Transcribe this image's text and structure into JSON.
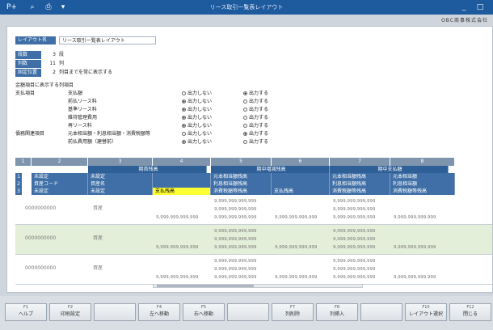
{
  "window": {
    "title": "リース取引一覧表レイアウト"
  },
  "company": "OBC商事株式会社",
  "layout": {
    "label": "レイアウト名",
    "value": "リース取引一覧表レイアウト"
  },
  "settings": [
    {
      "label": "段数",
      "value": "3",
      "unit": "段"
    },
    {
      "label": "列数",
      "value": "11",
      "unit": "列"
    },
    {
      "label": "固定位置",
      "value": "2",
      "unit": "列目までを常に表示する"
    }
  ],
  "section_title": "金額項目に表示する列項目",
  "radio_opts": {
    "off": "出力しない",
    "on": "出力する"
  },
  "columns": [
    {
      "group": "支払項目",
      "item": "支払額",
      "on": true
    },
    {
      "group": "",
      "item": "前払リース料",
      "on": false
    },
    {
      "group": "",
      "item": "基準リース料",
      "on": false
    },
    {
      "group": "",
      "item": "維持管理費用",
      "on": false
    },
    {
      "group": "",
      "item": "再リース料",
      "on": false
    },
    {
      "group": "債務関連項目",
      "item": "元本相当額・利息相当額・消費税額等",
      "on": true
    },
    {
      "group": "",
      "item": "前払費用額（建替前）",
      "on": false
    }
  ],
  "grid": {
    "col_numbers": [
      "1",
      "2",
      "3",
      "4",
      "5",
      "6",
      "7",
      "8"
    ],
    "groups": [
      "期首残高",
      "期中増減残高",
      "期中支払額"
    ],
    "header_rows": [
      {
        "n": "1",
        "c1": "未設定",
        "c2": "未設定",
        "g1": "元本相当額残高",
        "g2": "元本相当額残高",
        "g3": "元本相当額"
      },
      {
        "n": "2",
        "c1": "資産コード",
        "c2": "資産名",
        "g1": "利息相当額残高",
        "g2": "利息相当額残高",
        "g3": "利息相当額"
      },
      {
        "n": "3",
        "c1": "未設定",
        "c2": "未設定",
        "g0": "支払残高",
        "g1": "消費税額等残高",
        "g2b": "支払残高",
        "g2": "消費税額等残高",
        "g3b": "支払額",
        "g3": "消費税額等残高"
      }
    ],
    "rows": [
      {
        "code": "0000000000",
        "name": "資産",
        "v": "9,999,999,999,999"
      },
      {
        "code": "0000000000",
        "name": "資産",
        "v": "9,999,999,999,999"
      },
      {
        "code": "0000000000",
        "name": "資産",
        "v": "9,999,999,999,999"
      }
    ]
  },
  "fkeys": [
    {
      "n": "F1",
      "l": "ヘルプ"
    },
    {
      "n": "F2",
      "l": "印刷設定"
    },
    {
      "n": "",
      "l": ""
    },
    {
      "n": "F4",
      "l": "左へ移動"
    },
    {
      "n": "F5",
      "l": "右へ移動"
    },
    {
      "n": "",
      "l": ""
    },
    {
      "n": "F7",
      "l": "列削除"
    },
    {
      "n": "F8",
      "l": "列挿入"
    },
    {
      "n": "",
      "l": ""
    },
    {
      "n": "F10",
      "l": "レイアウト選択"
    },
    {
      "n": "F12",
      "l": "閉じる"
    }
  ]
}
